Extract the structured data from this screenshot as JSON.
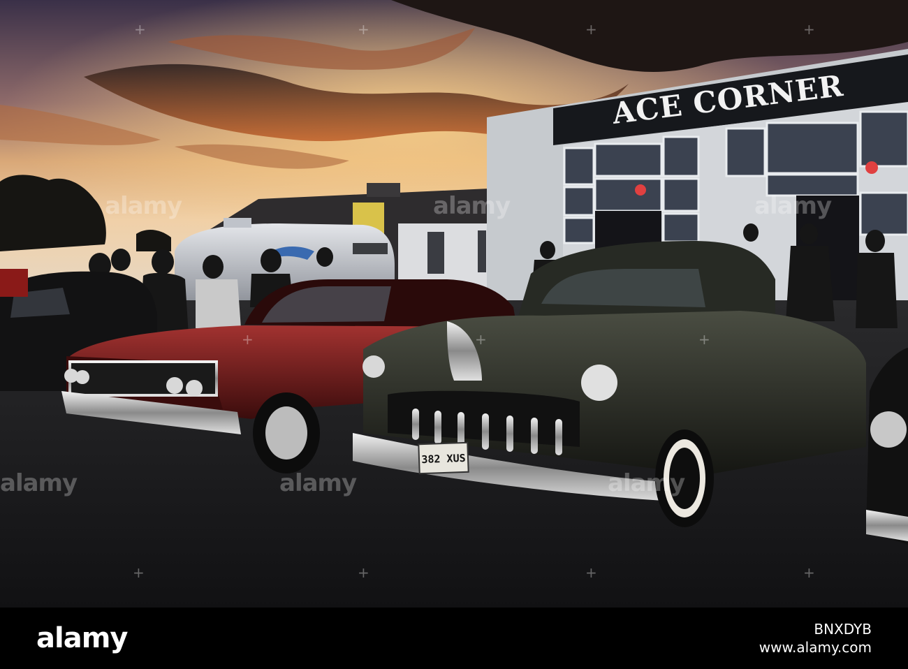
{
  "sign": {
    "text": "ACE CORNER"
  },
  "plate": {
    "text": "382 XUS"
  },
  "watermark": {
    "text": "alamy"
  },
  "footer": {
    "logo": "alamy",
    "image_id": "BNXDYB",
    "site": "www.alamy.com"
  },
  "colors": {
    "sky_top": "#2a2440",
    "sky_glow": "#e2843a",
    "building": "#c9cdd2",
    "fascia": "#16181c",
    "red_car": "#7a1c1a",
    "green_car": "#2e3128",
    "asphalt": "#202022",
    "background": "#000000"
  }
}
